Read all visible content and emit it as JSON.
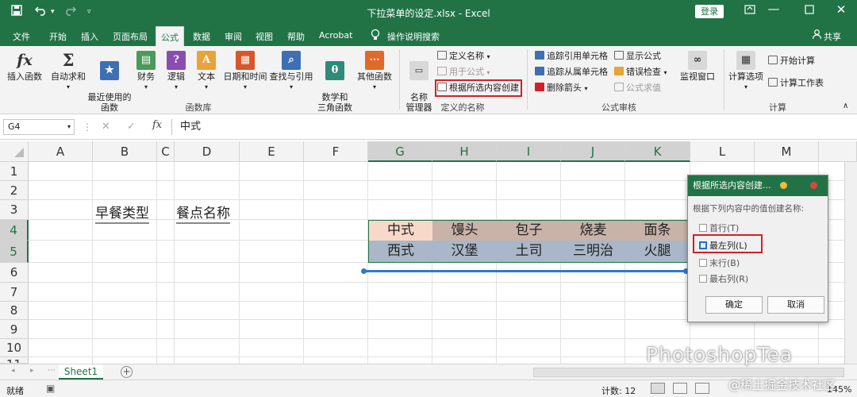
{
  "window": {
    "title": "下拉菜单的设定.xlsx  -  Excel",
    "login_label": "登录",
    "qa_save_icon": "save-icon",
    "qa_undo_icon": "undo-icon",
    "qa_redo_icon": "redo-icon",
    "restore_icon": "ribbon-display-icon",
    "min_icon": "minimize-icon",
    "max_icon": "maximize-icon",
    "close_icon": "close-icon"
  },
  "tabs": [
    "文件",
    "开始",
    "插入",
    "页面布局",
    "公式",
    "数据",
    "审阅",
    "视图",
    "帮助",
    "Acrobat",
    "操作说明搜索"
  ],
  "active_tab": "公式",
  "share_label": "共享",
  "ribbon": {
    "insert_function": "插入函数",
    "autosum": "自动求和",
    "recent": "最近使用的\n函数",
    "finance": "财务",
    "logic": "逻辑",
    "text": "文本",
    "datetime": "日期和时间",
    "lookup": "查找与引用",
    "math": "数学和\n三角函数",
    "other": "其他函数",
    "function_library": "函数库",
    "name_manager": "名称\n管理器",
    "define_name": "定义名称",
    "use_in_formula": "用于公式",
    "create_from_selection": "根据所选内容创建",
    "defined_names": "定义的名称",
    "trace_precedents": "追踪引用单元格",
    "trace_dependents": "追踪从属单元格",
    "remove_arrows": "删除箭头",
    "show_formulas": "显示公式",
    "error_checking": "错误检查",
    "evaluate_formula": "公式求值",
    "watch_window": "监视窗口",
    "formula_auditing": "公式审核",
    "calc_options": "计算选项",
    "calc_now": "开始计算",
    "calc_sheet": "计算工作表",
    "calculation": "计算",
    "fx_symbol": "fx",
    "sigma_symbol": "Σ"
  },
  "formula_bar": {
    "name_box": "G4",
    "content": "中式",
    "fx": "fx"
  },
  "sheet": {
    "columns": [
      "A",
      "B",
      "C",
      "D",
      "E",
      "F",
      "G",
      "H",
      "I",
      "J",
      "K",
      "L",
      "M"
    ],
    "rows": [
      "1",
      "2",
      "3",
      "4",
      "5",
      "6",
      "7",
      "8",
      "9",
      "10",
      "11"
    ],
    "b3": "早餐类型",
    "d3": "餐点名称",
    "row4": [
      "中式",
      "馒头",
      "包子",
      "烧麦",
      "面条"
    ],
    "row5": [
      "西式",
      "汉堡",
      "土司",
      "三明治",
      "火腿"
    ]
  },
  "sheet_tab": "Sheet1",
  "status": {
    "ready": "就绪",
    "count": "计数: 12",
    "zoom": "145%"
  },
  "dialog": {
    "title": "根据所选内容创建...",
    "prompt": "根据下列内容中的值创建名称:",
    "options": [
      "首行(T)",
      "最左列(L)",
      "末行(B)",
      "最右列(R)"
    ],
    "checked": [
      false,
      true,
      false,
      false
    ],
    "ok": "确定",
    "cancel": "取消"
  },
  "watermark": {
    "brand": "PhotoshopTea",
    "sub": "@稀土掘金技术社区"
  },
  "colors": {
    "excel_green": "#217346",
    "highlight_red": "#d32027",
    "row4_cell": "#f8d8c8",
    "row4_fill": "#c9b2a8",
    "row5_fill": "#a9b7c8",
    "drag_line": "#2f7ad0"
  }
}
